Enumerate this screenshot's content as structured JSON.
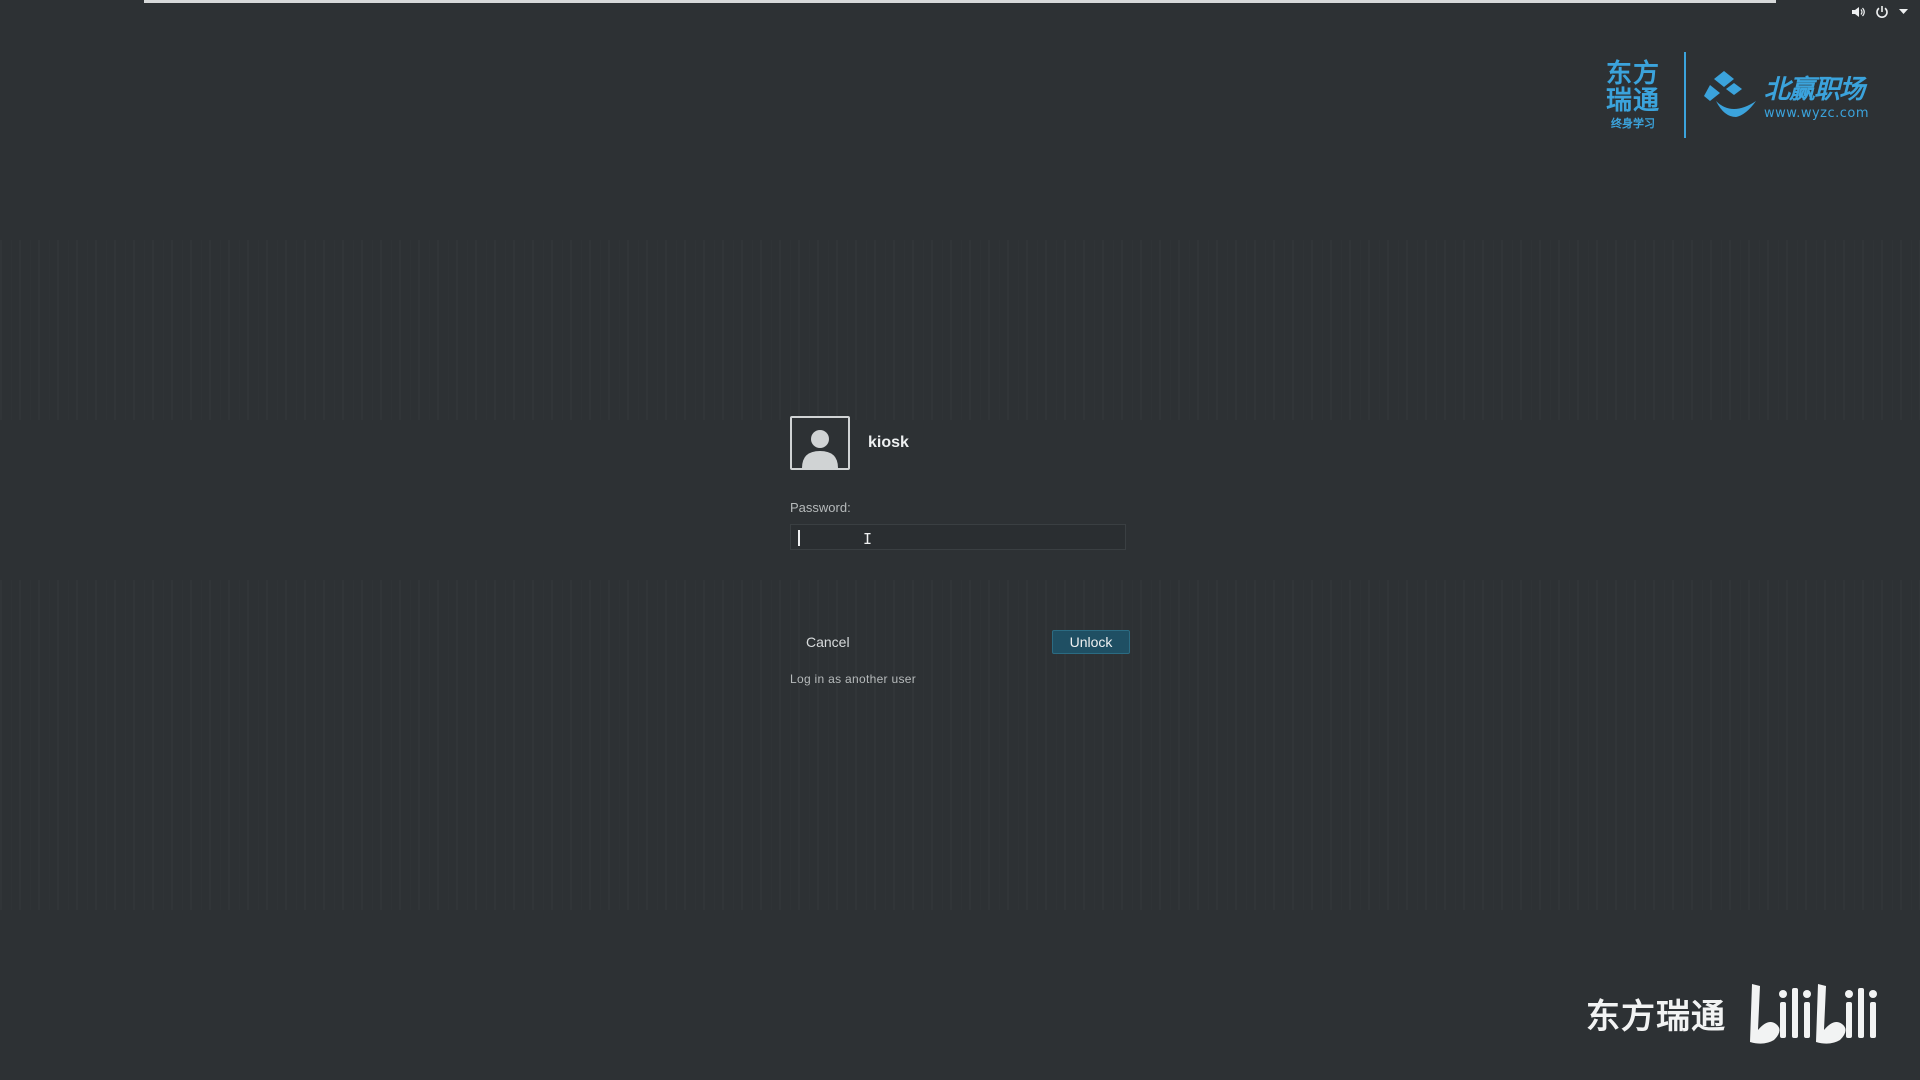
{
  "top_bar": {
    "volume_icon": "speaker-icon",
    "power_icon": "power-icon",
    "menu_icon": "chevron-down-icon"
  },
  "logo": {
    "left_title": "东方瑞通",
    "left_subtitle": "终身学习",
    "right_title": "北赢职场",
    "right_url": "www.wyzc.com",
    "color": "#3ba3dc"
  },
  "lock_dialog": {
    "username": "kiosk",
    "password_label": "Password:",
    "password_value": "",
    "cancel_label": "Cancel",
    "unlock_label": "Unlock",
    "other_user_label": "Log in as another user"
  },
  "watermark": {
    "text": "东方瑞通",
    "brand": "bilibili"
  },
  "colors": {
    "background": "#2d3134",
    "unlock_button": "#1f4f63",
    "text": "#e8eaeb"
  }
}
